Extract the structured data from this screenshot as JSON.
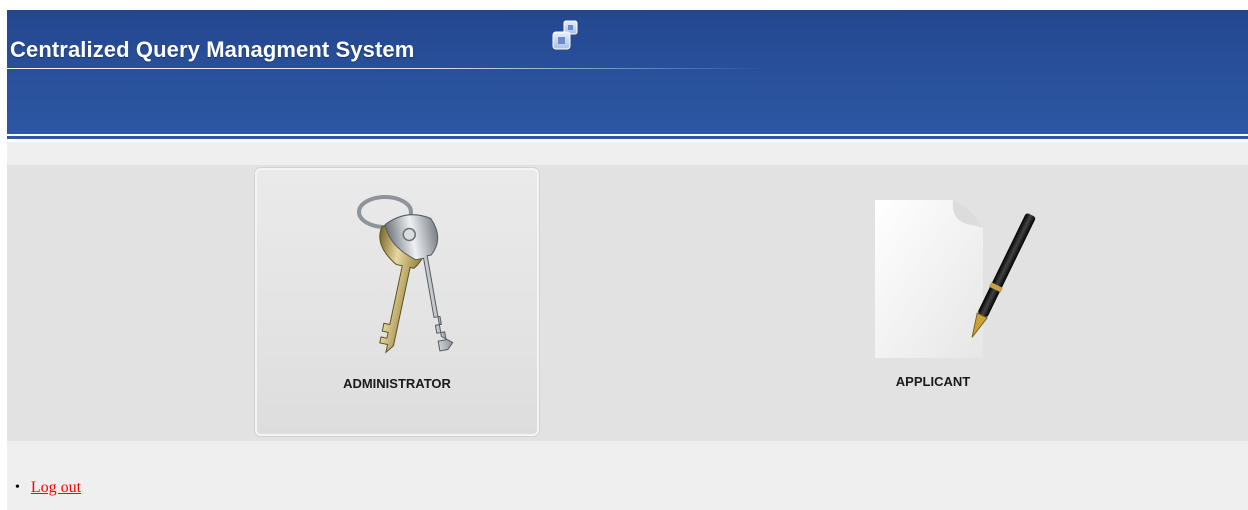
{
  "header": {
    "title": "Centralized Query Managment System",
    "logo_icon": "stacked-squares-icon",
    "background_color": "#2a509b"
  },
  "tiles": [
    {
      "label": "ADMINISTRATOR",
      "icon": "keys-icon"
    },
    {
      "label": "APPLICANT",
      "icon": "document-pen-icon"
    }
  ],
  "footer": {
    "logout_label": "Log out",
    "link_color": "#ff0000"
  }
}
